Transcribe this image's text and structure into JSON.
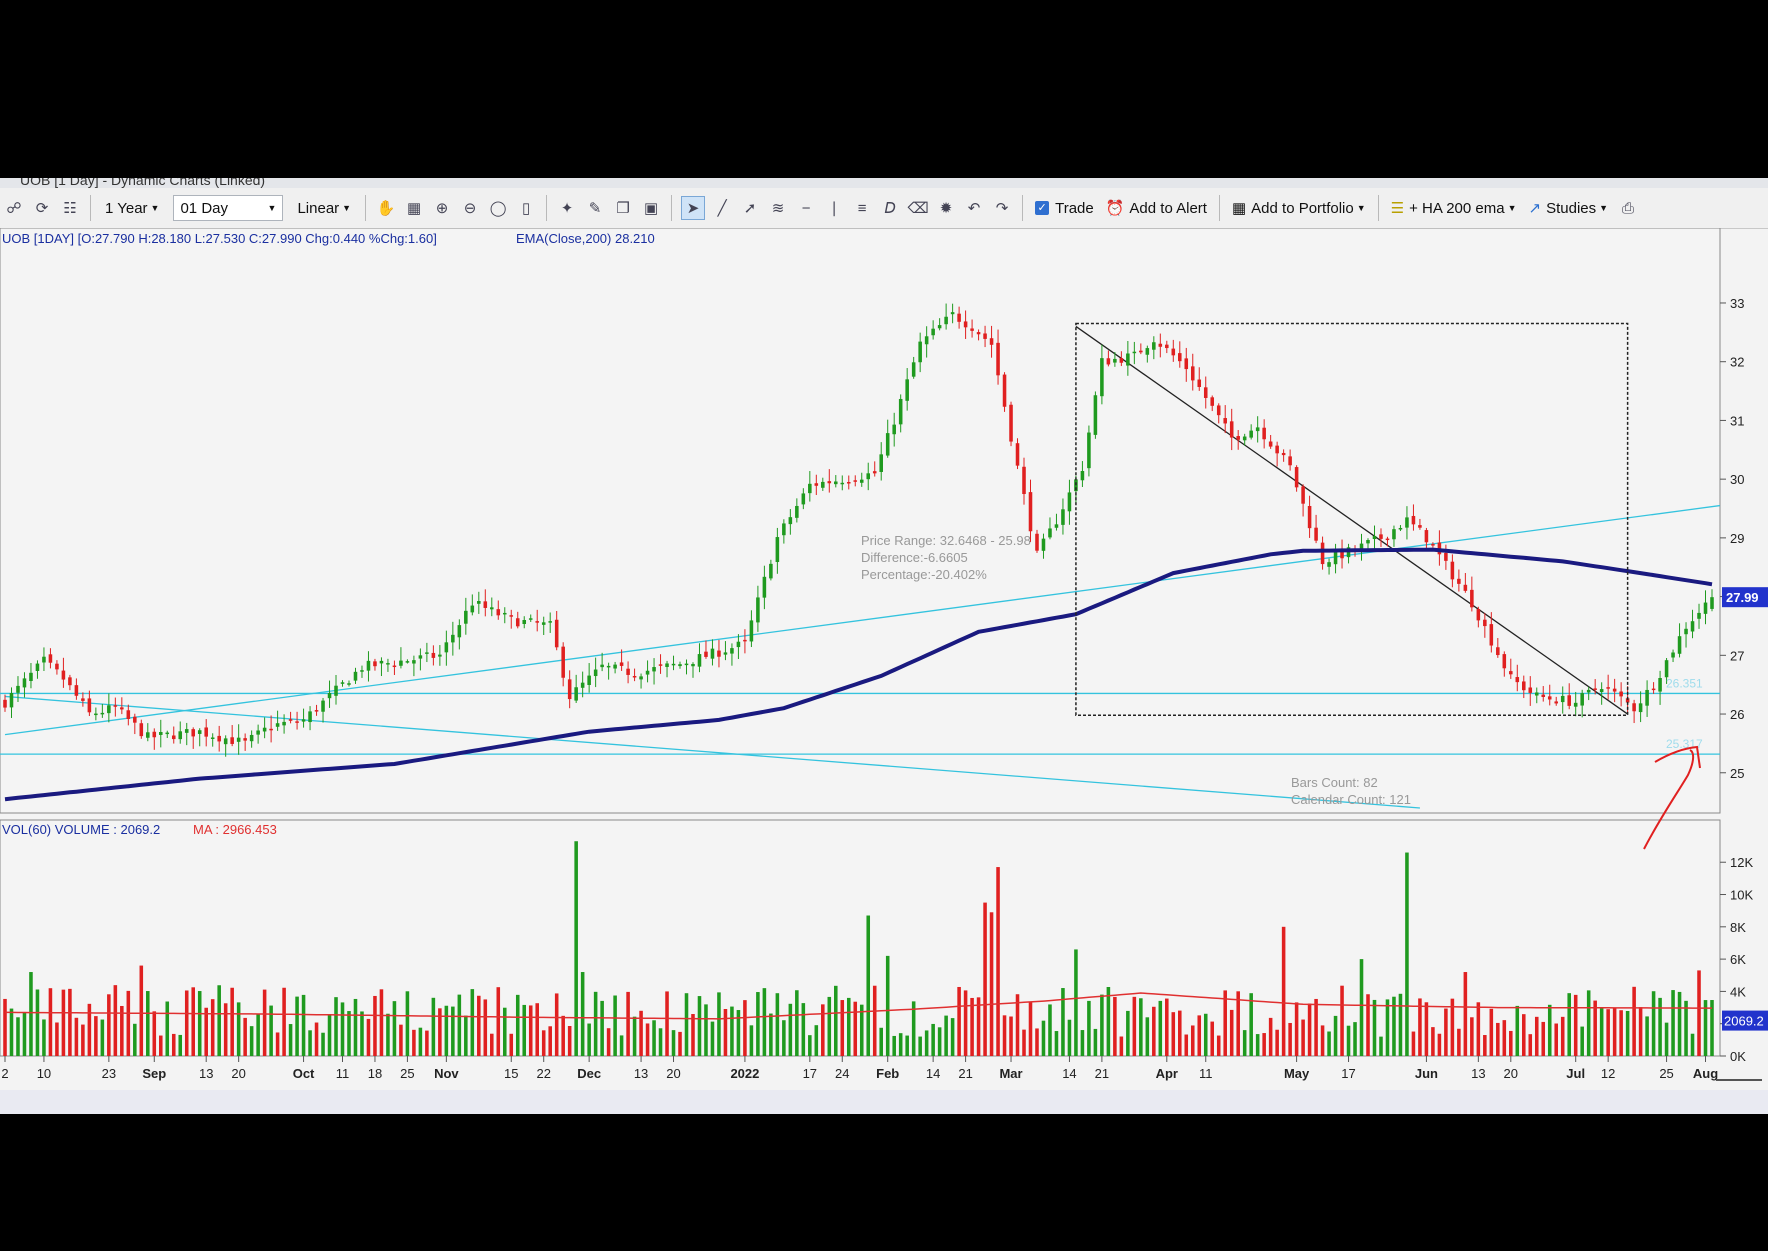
{
  "window": {
    "title": "UOB [1 Day] - Dynamic Charts (Linked)"
  },
  "toolbar": {
    "period_label": "1 Year",
    "interval_value": "01 Day",
    "scale_label": "Linear",
    "trade_label": "Trade",
    "add_alert_label": "Add to Alert",
    "add_portfolio_label": "Add to Portfolio",
    "indicator_label": "+ HA 200 ema",
    "studies_label": "Studies"
  },
  "price_panel": {
    "header_text": "UOB [1DAY] [O:27.790 H:28.180 L:27.530 C:27.990 Chg:0.440 %Chg:1.60]",
    "ema_text": "EMA(Close,200) 28.210",
    "last_price_badge": "27.99",
    "range_annotation": [
      "Price Range: 32.6468 - 25.98",
      "Difference:-6.6605",
      "Percentage:-20.402%"
    ],
    "count_annotation": [
      "Bars Count: 82",
      "Calendar Count: 121"
    ],
    "support_labels": [
      "26.351",
      "25.317"
    ]
  },
  "volume_panel": {
    "header_text": "VOL(60)  VOLUME : 2069.2",
    "ma_text": "MA : 2966.453",
    "last_volume_badge": "2069.2"
  },
  "colors": {
    "up": "#1f9a1f",
    "down": "#e02020",
    "ema": "#1a1a80",
    "trendline": "#34c3de",
    "volume_ma": "#e03030",
    "badge": "#2233cc",
    "annotation": "#999999"
  },
  "chart_data": {
    "type": "candlestick",
    "symbol": "UOB",
    "y_ticks": [
      25,
      26,
      27,
      28,
      29,
      30,
      31,
      32,
      33
    ],
    "ylim": [
      24.4,
      33.8
    ],
    "volume_ticks": [
      "0K",
      "2K",
      "4K",
      "6K",
      "8K",
      "10K",
      "12K"
    ],
    "volume_ylim": [
      0,
      13500
    ],
    "x_tick_labels": [
      {
        "label": "2",
        "i": 0
      },
      {
        "label": "10",
        "i": 6
      },
      {
        "label": "23",
        "i": 16
      },
      {
        "label": "Sep",
        "i": 23,
        "major": true
      },
      {
        "label": "13",
        "i": 31
      },
      {
        "label": "20",
        "i": 36
      },
      {
        "label": "Oct",
        "i": 46,
        "major": true
      },
      {
        "label": "11",
        "i": 52
      },
      {
        "label": "18",
        "i": 57
      },
      {
        "label": "25",
        "i": 62
      },
      {
        "label": "Nov",
        "i": 68,
        "major": true
      },
      {
        "label": "15",
        "i": 78
      },
      {
        "label": "22",
        "i": 83
      },
      {
        "label": "Dec",
        "i": 90,
        "major": true
      },
      {
        "label": "13",
        "i": 98
      },
      {
        "label": "20",
        "i": 103
      },
      {
        "label": "2022",
        "i": 114,
        "major": true
      },
      {
        "label": "17",
        "i": 124
      },
      {
        "label": "24",
        "i": 129
      },
      {
        "label": "Feb",
        "i": 136,
        "major": true
      },
      {
        "label": "14",
        "i": 143
      },
      {
        "label": "21",
        "i": 148
      },
      {
        "label": "Mar",
        "i": 155,
        "major": true
      },
      {
        "label": "14",
        "i": 164
      },
      {
        "label": "21",
        "i": 169
      },
      {
        "label": "Apr",
        "i": 179,
        "major": true
      },
      {
        "label": "11",
        "i": 185
      },
      {
        "label": "May",
        "i": 199,
        "major": true
      },
      {
        "label": "17",
        "i": 207
      },
      {
        "label": "Jun",
        "i": 219,
        "major": true
      },
      {
        "label": "13",
        "i": 227
      },
      {
        "label": "20",
        "i": 232
      },
      {
        "label": "Jul",
        "i": 242,
        "major": true
      },
      {
        "label": "12",
        "i": 247
      },
      {
        "label": "25",
        "i": 256
      },
      {
        "label": "Aug",
        "i": 262,
        "major": true
      }
    ],
    "close_anchors": [
      [
        0,
        26.2
      ],
      [
        6,
        26.9
      ],
      [
        9,
        26.6
      ],
      [
        13,
        26.0
      ],
      [
        17,
        26.1
      ],
      [
        22,
        25.6
      ],
      [
        30,
        25.7
      ],
      [
        37,
        25.5
      ],
      [
        41,
        25.8
      ],
      [
        46,
        25.9
      ],
      [
        55,
        26.8
      ],
      [
        67,
        27.0
      ],
      [
        72,
        27.9
      ],
      [
        78,
        27.6
      ],
      [
        84,
        27.5
      ],
      [
        87,
        26.3
      ],
      [
        92,
        26.8
      ],
      [
        97,
        26.7
      ],
      [
        104,
        26.85
      ],
      [
        114,
        27.2
      ],
      [
        119,
        29.0
      ],
      [
        124,
        29.9
      ],
      [
        129,
        30.0
      ],
      [
        134,
        30.1
      ],
      [
        137,
        31.0
      ],
      [
        141,
        32.3
      ],
      [
        146,
        32.8
      ],
      [
        149,
        32.6
      ],
      [
        152,
        32.3
      ],
      [
        156,
        30.2
      ],
      [
        159,
        28.7
      ],
      [
        162,
        29.3
      ],
      [
        166,
        30.2
      ],
      [
        169,
        32.0
      ],
      [
        174,
        32.1
      ],
      [
        177,
        32.4
      ],
      [
        182,
        31.9
      ],
      [
        189,
        30.7
      ],
      [
        193,
        30.9
      ],
      [
        198,
        30.2
      ],
      [
        203,
        28.6
      ],
      [
        208,
        28.8
      ],
      [
        212,
        29.0
      ],
      [
        216,
        29.3
      ],
      [
        219,
        29.0
      ],
      [
        226,
        27.9
      ],
      [
        232,
        26.6
      ],
      [
        236,
        26.3
      ],
      [
        242,
        26.2
      ],
      [
        246,
        26.5
      ],
      [
        251,
        26.1
      ],
      [
        254,
        26.5
      ],
      [
        259,
        27.5
      ],
      [
        263,
        27.99
      ]
    ],
    "ema200_anchors": [
      [
        0,
        24.55
      ],
      [
        30,
        24.9
      ],
      [
        60,
        25.15
      ],
      [
        90,
        25.7
      ],
      [
        110,
        25.9
      ],
      [
        120,
        26.1
      ],
      [
        135,
        26.65
      ],
      [
        150,
        27.4
      ],
      [
        165,
        27.7
      ],
      [
        180,
        28.4
      ],
      [
        195,
        28.72
      ],
      [
        200,
        28.78
      ],
      [
        220,
        28.8
      ],
      [
        240,
        28.6
      ],
      [
        252,
        28.4
      ],
      [
        263,
        28.21
      ]
    ],
    "trend_lines": [
      {
        "from": [
          0,
          25.65
        ],
        "to": [
          270,
          29.55
        ]
      },
      {
        "from": [
          0,
          26.3
        ],
        "to": [
          218,
          24.4
        ]
      },
      {
        "from": [
          165,
          32.6
        ],
        "to": [
          250,
          26.0
        ]
      }
    ],
    "support_lines": [
      26.351,
      25.317
    ],
    "measure_box": {
      "from_i": 165,
      "to_i": 250,
      "top": 32.65,
      "bottom": 25.98
    },
    "volume_spikes": [
      [
        4,
        5200
      ],
      [
        21,
        5600
      ],
      [
        88,
        13300
      ],
      [
        89,
        5200
      ],
      [
        133,
        8700
      ],
      [
        136,
        6200
      ],
      [
        151,
        9500
      ],
      [
        153,
        11700
      ],
      [
        152,
        8900
      ],
      [
        165,
        6600
      ],
      [
        197,
        8000
      ],
      [
        209,
        6000
      ],
      [
        216,
        12600
      ],
      [
        225,
        5200
      ],
      [
        261,
        5300
      ],
      [
        255,
        3600
      ]
    ],
    "volume_ma_anchors": [
      [
        0,
        2700
      ],
      [
        40,
        2600
      ],
      [
        80,
        2400
      ],
      [
        110,
        2300
      ],
      [
        140,
        2900
      ],
      [
        160,
        3400
      ],
      [
        175,
        3900
      ],
      [
        200,
        3200
      ],
      [
        230,
        3000
      ],
      [
        263,
        2966
      ]
    ]
  }
}
